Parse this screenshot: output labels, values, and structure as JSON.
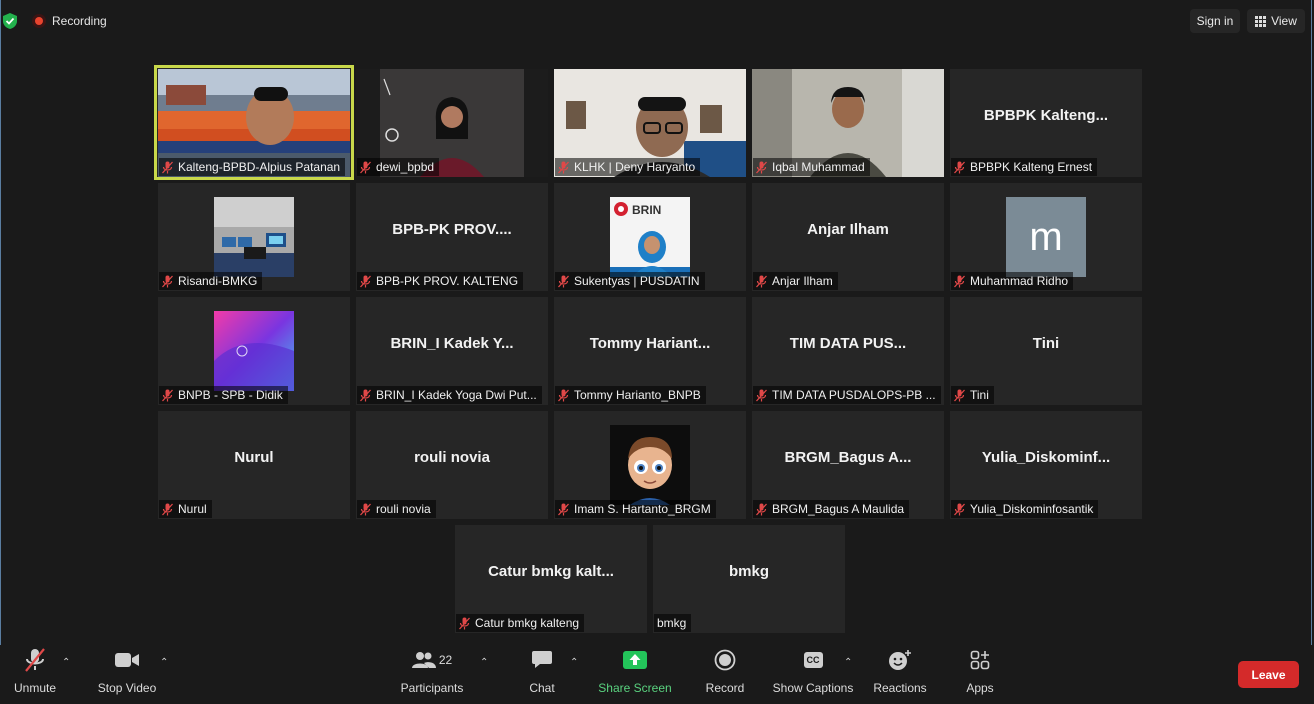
{
  "topbar": {
    "recording_label": "Recording",
    "signin_label": "Sign in",
    "view_label": "View"
  },
  "tiles": [
    {
      "label": "Kalteng-BPBD-Alpius Patanan",
      "name": "",
      "video": "banner-speaker",
      "active": true
    },
    {
      "label": "dewi_bpbd",
      "name": "",
      "video": "woman-dark"
    },
    {
      "label": "KLHK | Deny Haryanto",
      "name": "",
      "video": "office-man"
    },
    {
      "label": "Iqbal Muhammad",
      "name": "",
      "video": "young-man"
    },
    {
      "label": "BPBPK Kalteng Ernest",
      "name": "BPBPK  Kalteng...",
      "video": ""
    },
    {
      "label": "Risandi-BMKG",
      "name": "",
      "video": "control-room"
    },
    {
      "label": "BPB-PK PROV. KALTENG",
      "name": "BPB-PK  PROV....",
      "video": ""
    },
    {
      "label": "Sukentyas | PUSDATIN",
      "name": "",
      "video": "brin-logo"
    },
    {
      "label": "Anjar Ilham",
      "name": "Anjar Ilham",
      "video": ""
    },
    {
      "label": "Muhammad Ridho",
      "name": "",
      "video": "initial-m"
    },
    {
      "label": "BNPB - SPB - Didik",
      "name": "",
      "video": "gradient"
    },
    {
      "label": "BRIN_I Kadek Yoga Dwi Put...",
      "name": "BRIN_I  Kadek  Y...",
      "video": ""
    },
    {
      "label": "Tommy Harianto_BNPB",
      "name": "Tommy  Hariant...",
      "video": ""
    },
    {
      "label": "TIM DATA PUSDALOPS-PB ...",
      "name": "TIM DATA  PUS...",
      "video": ""
    },
    {
      "label": "Tini",
      "name": "Tini",
      "video": ""
    },
    {
      "label": "Nurul",
      "name": "Nurul",
      "video": ""
    },
    {
      "label": "rouli novia",
      "name": "rouli novia",
      "video": ""
    },
    {
      "label": "Imam S. Hartanto_BRGM",
      "name": "",
      "video": "cartoon-avatar"
    },
    {
      "label": "BRGM_Bagus A Maulida",
      "name": "BRGM_Bagus  A...",
      "video": ""
    },
    {
      "label": "Yulia_Diskominfosantik",
      "name": "Yulia_Diskominf...",
      "video": ""
    },
    {
      "label": "Catur bmkg kalteng",
      "name": "Catur  bmkg  kalt...",
      "video": ""
    },
    {
      "label": "bmkg",
      "name": "bmkg",
      "video": "",
      "mic": "none"
    }
  ],
  "brin_text": "BRIN",
  "initial_m": "m",
  "toolbar": {
    "unmute": "Unmute",
    "stop_video": "Stop Video",
    "participants": "Participants",
    "participant_count": "22",
    "chat": "Chat",
    "share_screen": "Share Screen",
    "record": "Record",
    "show_captions": "Show Captions",
    "cc": "CC",
    "reactions": "Reactions",
    "apps": "Apps",
    "leave": "Leave"
  },
  "colors": {
    "active_speaker": "#c8d84a",
    "leave": "#d42a2a",
    "share": "#23c45a",
    "mic_muted": "#e04848"
  }
}
